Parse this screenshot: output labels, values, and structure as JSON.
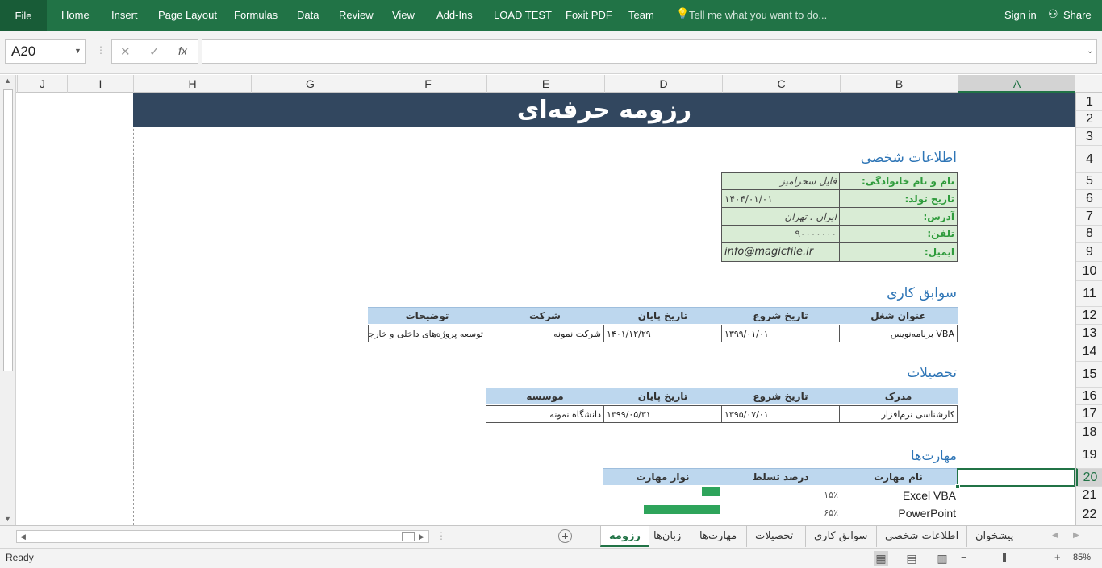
{
  "ribbon": {
    "file": "File",
    "tabs": [
      "Home",
      "Insert",
      "Page Layout",
      "Formulas",
      "Data",
      "Review",
      "View",
      "Add-Ins",
      "LOAD TEST",
      "Foxit PDF",
      "Team"
    ],
    "tell_me": "Tell me what you want to do...",
    "sign_in": "Sign in",
    "share": "Share"
  },
  "formula_bar": {
    "name_box": "A20",
    "cancel": "✕",
    "enter": "✓",
    "fx": "fx",
    "formula": ""
  },
  "columns": [
    "J",
    "I",
    "H",
    "G",
    "F",
    "E",
    "D",
    "C",
    "B",
    "A"
  ],
  "rows": [
    "1",
    "2",
    "3",
    "4",
    "5",
    "6",
    "7",
    "8",
    "9",
    "10",
    "11",
    "12",
    "13",
    "14",
    "15",
    "16",
    "17",
    "18",
    "19",
    "20",
    "21",
    "22"
  ],
  "sheet": {
    "banner": "رزومه حرفه‌ای",
    "personal": {
      "title": "اطلاعات شخصی",
      "rows": [
        {
          "label": "نام و نام خانوادگی:",
          "value": "فایل سحرآمیز"
        },
        {
          "label": "تاریخ تولد:",
          "value": "۱۴۰۴/۰۱/۰۱"
        },
        {
          "label": "آدرس:",
          "value": "ایران . تهران"
        },
        {
          "label": "تلفن:",
          "value": "۹۰۰۰۰۰۰۰"
        },
        {
          "label": "ایمیل:",
          "value": "info@magicfile.ir"
        }
      ]
    },
    "work": {
      "title": "سوابق کاری",
      "headers": [
        "عنوان شغل",
        "تاریخ شروع",
        "تاریخ پایان",
        "شرکت",
        "توضیحات"
      ],
      "rows": [
        [
          "برنامه‌نویس VBA",
          "۱۳۹۹/۰۱/۰۱",
          "۱۴۰۱/۱۲/۲۹",
          "شرکت نمونه",
          "توسعه پروژه‌های داخلی و خارجی"
        ]
      ]
    },
    "education": {
      "title": "تحصیلات",
      "headers": [
        "مدرک",
        "تاریخ شروع",
        "تاریخ پایان",
        "موسسه"
      ],
      "rows": [
        [
          "کارشناسی نرم‌افزار",
          "۱۳۹۵/۰۷/۰۱",
          "۱۳۹۹/۰۵/۳۱",
          "دانشگاه نمونه"
        ]
      ]
    },
    "skills": {
      "title": "مهارت‌ها",
      "headers": [
        "نام مهارت",
        "درصد تسلط",
        "نوار مهارت"
      ],
      "rows": [
        {
          "name": "Excel VBA",
          "percent": "۱۵٪",
          "level": 0.15
        },
        {
          "name": "PowerPoint",
          "percent": "۶۵٪",
          "level": 0.65
        }
      ]
    }
  },
  "sheets": [
    "پیشخوان",
    "اطلاعات شخصی",
    "سوابق کاری",
    "تحصیلات",
    "مهارت‌ها",
    "زبان‌ها",
    "رزومه"
  ],
  "active_sheet": "رزومه",
  "status": {
    "text": "Ready",
    "zoom": "85%"
  },
  "colors": {
    "ribbon": "#217346",
    "banner": "#32475f",
    "label_green": "#2f9b3c",
    "header_blue": "#bdd7ee",
    "bar_green": "#2ea45b"
  }
}
